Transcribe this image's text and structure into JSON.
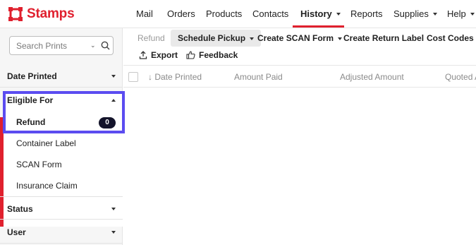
{
  "brand": {
    "name": "Stamps",
    "color": "#e0202e"
  },
  "nav": {
    "items": [
      {
        "label": "Mail",
        "dropdown": false
      },
      {
        "label": "Orders",
        "dropdown": false
      },
      {
        "label": "Products",
        "dropdown": false
      },
      {
        "label": "Contacts",
        "dropdown": false
      },
      {
        "label": "History",
        "dropdown": true,
        "active": true
      },
      {
        "label": "Reports",
        "dropdown": false
      },
      {
        "label": "Supplies",
        "dropdown": true
      },
      {
        "label": "Help",
        "dropdown": true
      }
    ]
  },
  "search": {
    "placeholder": "Search Prints"
  },
  "sidebar": {
    "date_printed": "Date Printed",
    "eligible_for": "Eligible For",
    "options": [
      {
        "label": "Refund",
        "count": "0",
        "selected": true
      },
      {
        "label": "Container Label"
      },
      {
        "label": "SCAN Form"
      },
      {
        "label": "Insurance Claim"
      }
    ],
    "status": "Status",
    "user": "User"
  },
  "toolbar": {
    "refund": "Refund",
    "schedule_pickup": "Schedule Pickup",
    "create_scan_form": "Create SCAN Form",
    "create_return_label": "Create Return Label",
    "cost_codes": "Cost Codes",
    "export": "Export",
    "feedback": "Feedback"
  },
  "table": {
    "columns": [
      "↓ Date Printed",
      "Amount Paid",
      "Adjusted Amount",
      "Quoted A"
    ]
  },
  "colors": {
    "accent": "#e0202e",
    "highlight": "#5b4cf0",
    "pill": "#14142b"
  }
}
